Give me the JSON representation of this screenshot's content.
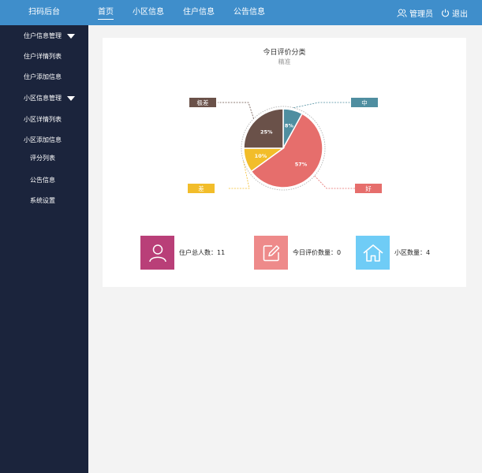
{
  "header": {
    "brand": "扫码后台",
    "nav": [
      "首页",
      "小区信息",
      "住户信息",
      "公告信息"
    ],
    "admin": "管理员",
    "logout": "退出"
  },
  "sidebar": {
    "group1": "住户信息管理",
    "item1": "住户详情列表",
    "item2": "住户添加信息",
    "group2": "小区信息管理",
    "item3": "小区详情列表",
    "item4": "小区添加信息",
    "item5": "评分列表",
    "item6": "公告信息",
    "item7": "系统设置"
  },
  "panel": {
    "title": "今日评价分类",
    "subtitle": "精准"
  },
  "chart_data": {
    "type": "pie",
    "title": "今日评价分类",
    "subtitle": "精准",
    "slices": [
      {
        "label": "中",
        "value": 8,
        "text": "8%",
        "color": "#4f8ea0"
      },
      {
        "label": "好",
        "value": 57,
        "text": "57%",
        "color": "#e66e6c"
      },
      {
        "label": "差",
        "value": 10,
        "text": "10%",
        "color": "#f2bd2a"
      },
      {
        "label": "极差",
        "value": 25,
        "text": "25%",
        "color": "#6a5149"
      }
    ]
  },
  "stats": [
    {
      "label": "住户总人数：11",
      "color": "#b93f78",
      "icon": "user-icon"
    },
    {
      "label": "今日评价数量：0",
      "color": "#ee8a8a",
      "icon": "edit-icon"
    },
    {
      "label": "小区数量：4",
      "color": "#6fccf6",
      "icon": "house-icon"
    }
  ]
}
